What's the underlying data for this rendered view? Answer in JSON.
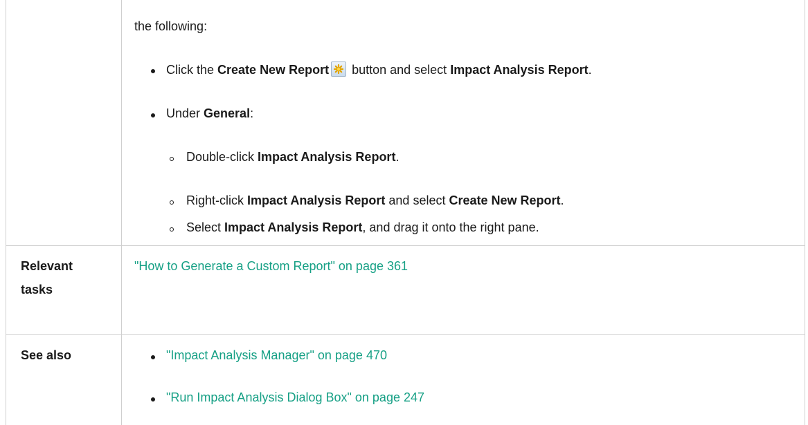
{
  "row1": {
    "intro": "the following:",
    "bullet1": {
      "pre": "Click the ",
      "b1": "Create New Report",
      "mid": " button and select ",
      "b2": "Impact Analysis Report",
      "post": "."
    },
    "bullet2": {
      "pre": "Under ",
      "b1": "General",
      "post": ":"
    },
    "sub1": {
      "pre": "Double-click ",
      "b1": "Impact Analysis Report",
      "post": "."
    },
    "sub2": {
      "pre": "Right-click ",
      "b1": "Impact Analysis Report",
      "mid": " and select ",
      "b2": "Create New Report",
      "post": "."
    },
    "sub3": {
      "pre": "Select ",
      "b1": "Impact Analysis Report",
      "post": ", and drag it onto the right pane."
    }
  },
  "row2": {
    "label_line1": "Relevant",
    "label_line2": "tasks",
    "link": "\"How to Generate a Custom Report\" on page 361"
  },
  "row3": {
    "label": "See also",
    "links": [
      "\"Impact Analysis Manager\" on page 470",
      "\"Run Impact Analysis Dialog Box\" on page 247"
    ]
  },
  "icons": {
    "create_report": "new-report-icon"
  }
}
